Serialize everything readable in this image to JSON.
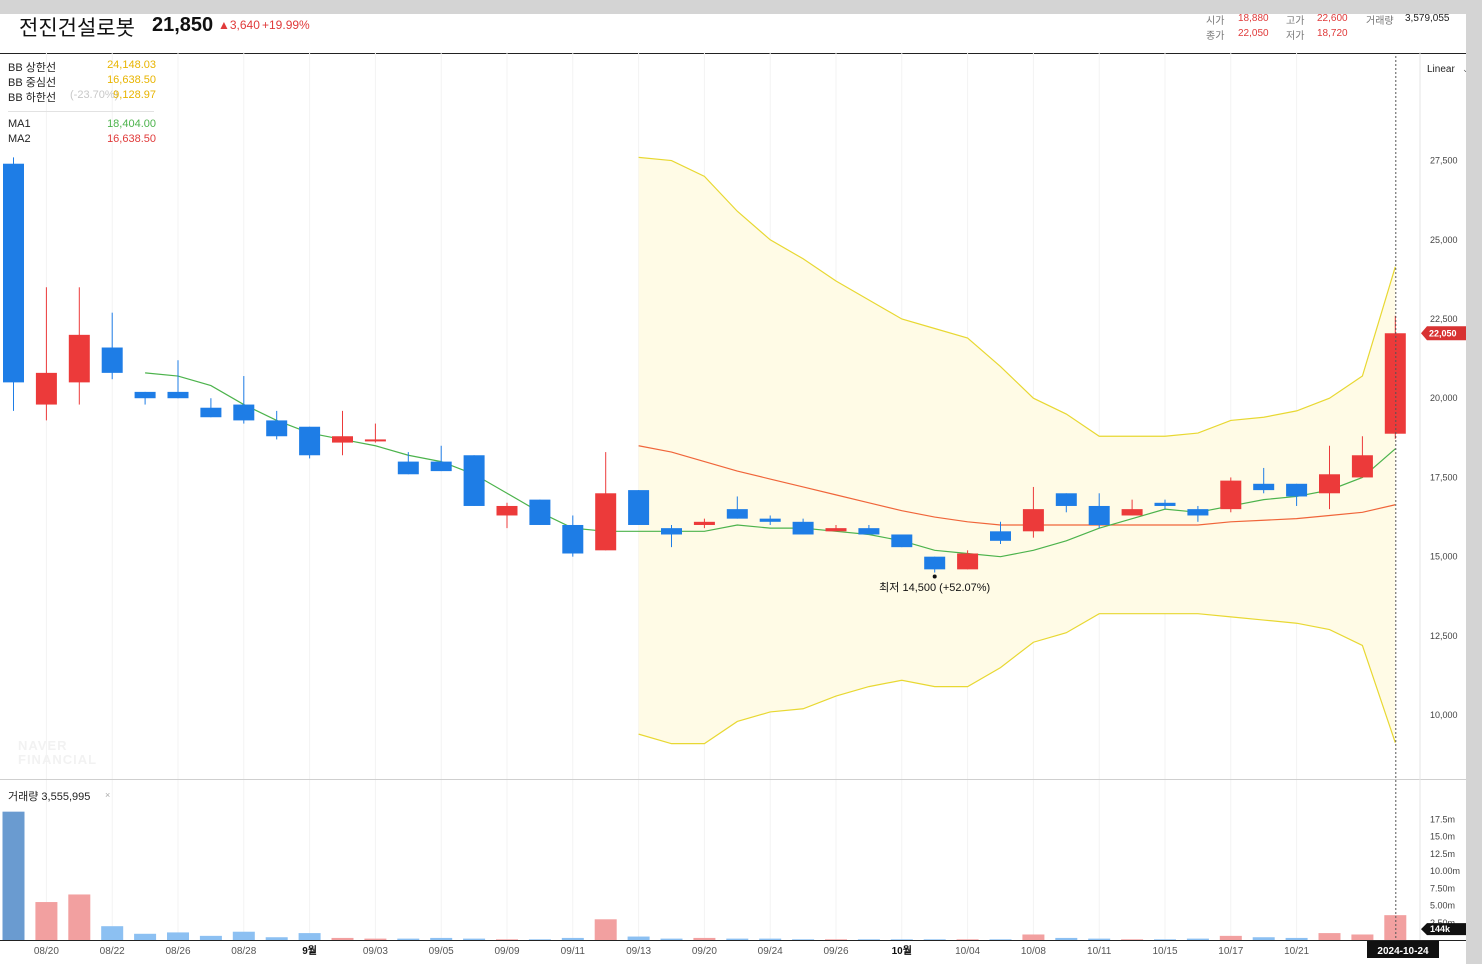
{
  "header": {
    "name": "전진건설로봇",
    "price": "21,850",
    "change": "▲3,640",
    "change_pct": "+19.99%",
    "open_label": "시가",
    "open_value": "18,880",
    "high_label": "고가",
    "high_value": "22,600",
    "volume_label": "거래량",
    "volume_value": "3,579,055",
    "close_label": "종가",
    "close_value": "22,050",
    "low_label": "저가",
    "low_value": "18,720"
  },
  "legend": {
    "bb_upper": {
      "label": "BB 상한선",
      "value": "24,148.03"
    },
    "bb_middle": {
      "label": "BB 중심선",
      "value": "16,638.50"
    },
    "bb_lower": {
      "label": "BB 하한선",
      "value": "9,128.97",
      "ghost": "(-23.70%)"
    },
    "ma1": {
      "label": "MA1",
      "value": "18,404.00"
    },
    "ma2": {
      "label": "MA2",
      "value": "16,638.50"
    }
  },
  "scale_mode": "Linear",
  "volume_panel": {
    "label": "거래량 3,555,995",
    "close": "×"
  },
  "watermark": {
    "line1": "NAVER",
    "line2": "FINANCIAL"
  },
  "colors": {
    "up": "#ec3a3a",
    "down": "#1e7de6",
    "up_volume": "#f2a0a0",
    "down_volume": "#8cc0f2",
    "ma1": "#4cb34c",
    "ma2": "#f0653a",
    "bb_band": "#e8d832",
    "bb_fill": "#fffbe6",
    "legend_bb": "#e8b400",
    "legend_ma1": "#4cb34c",
    "legend_ma2": "#e03a3a"
  },
  "chart_data": {
    "type": "candlestick",
    "price_axis": {
      "min": 8000,
      "max": 29000,
      "ticks": [
        "27,500",
        "25,000",
        "22,500",
        "20,000",
        "17,500",
        "15,000",
        "12,500",
        "10,000"
      ]
    },
    "volume_axis": {
      "ticks": [
        "17.5m",
        "15.0m",
        "12.5m",
        "10.00m",
        "7.50m",
        "5.00m",
        "2.50m"
      ]
    },
    "x_tick_labels": [
      {
        "i": 1,
        "label": "08/20"
      },
      {
        "i": 3,
        "label": "08/22"
      },
      {
        "i": 5,
        "label": "08/26"
      },
      {
        "i": 7,
        "label": "08/28"
      },
      {
        "i": 9,
        "label": "9월"
      },
      {
        "i": 11,
        "label": "09/03"
      },
      {
        "i": 13,
        "label": "09/05"
      },
      {
        "i": 15,
        "label": "09/09"
      },
      {
        "i": 17,
        "label": "09/11"
      },
      {
        "i": 19,
        "label": "09/13"
      },
      {
        "i": 21,
        "label": "09/20"
      },
      {
        "i": 23,
        "label": "09/24"
      },
      {
        "i": 25,
        "label": "09/26"
      },
      {
        "i": 27,
        "label": "10월"
      },
      {
        "i": 29,
        "label": "10/04"
      },
      {
        "i": 31,
        "label": "10/08"
      },
      {
        "i": 33,
        "label": "10/11"
      },
      {
        "i": 35,
        "label": "10/15"
      },
      {
        "i": 37,
        "label": "10/17"
      },
      {
        "i": 39,
        "label": "10/21"
      }
    ],
    "current_date": "2024-10-24",
    "current_price_tag": "22,050",
    "current_volume_tag": "144k",
    "low_annotation": {
      "index": 28,
      "price": 14500,
      "text": "최저 14,500 (+52.07%)"
    },
    "candles": [
      {
        "o": 27400,
        "h": 27600,
        "l": 19600,
        "c": 20500
      },
      {
        "o": 19800,
        "h": 23500,
        "l": 19300,
        "c": 20800
      },
      {
        "o": 20500,
        "h": 23500,
        "l": 19800,
        "c": 22000
      },
      {
        "o": 21600,
        "h": 22700,
        "l": 20600,
        "c": 20800
      },
      {
        "o": 20200,
        "h": 20200,
        "l": 19800,
        "c": 20000
      },
      {
        "o": 20200,
        "h": 21200,
        "l": 20000,
        "c": 20000
      },
      {
        "o": 19700,
        "h": 20000,
        "l": 19400,
        "c": 19400
      },
      {
        "o": 19800,
        "h": 20700,
        "l": 19200,
        "c": 19300
      },
      {
        "o": 19300,
        "h": 19600,
        "l": 18700,
        "c": 18800
      },
      {
        "o": 19100,
        "h": 19100,
        "l": 18100,
        "c": 18200
      },
      {
        "o": 18600,
        "h": 19600,
        "l": 18200,
        "c": 18800
      },
      {
        "o": 18700,
        "h": 19200,
        "l": 18600,
        "c": 18700
      },
      {
        "o": 18000,
        "h": 18300,
        "l": 17600,
        "c": 17600
      },
      {
        "o": 18000,
        "h": 18500,
        "l": 17700,
        "c": 17700
      },
      {
        "o": 18200,
        "h": 18200,
        "l": 16600,
        "c": 16600
      },
      {
        "o": 16300,
        "h": 16700,
        "l": 15900,
        "c": 16600
      },
      {
        "o": 16800,
        "h": 16800,
        "l": 16000,
        "c": 16000
      },
      {
        "o": 16000,
        "h": 16300,
        "l": 15000,
        "c": 15100
      },
      {
        "o": 15200,
        "h": 18300,
        "l": 15200,
        "c": 17000
      },
      {
        "o": 17100,
        "h": 17100,
        "l": 16000,
        "c": 16000
      },
      {
        "o": 15900,
        "h": 16000,
        "l": 15300,
        "c": 15700
      },
      {
        "o": 16000,
        "h": 16200,
        "l": 15900,
        "c": 16100
      },
      {
        "o": 16500,
        "h": 16900,
        "l": 16200,
        "c": 16200
      },
      {
        "o": 16200,
        "h": 16300,
        "l": 16000,
        "c": 16100
      },
      {
        "o": 16100,
        "h": 16200,
        "l": 15700,
        "c": 15700
      },
      {
        "o": 15800,
        "h": 16000,
        "l": 15800,
        "c": 15900
      },
      {
        "o": 15900,
        "h": 16000,
        "l": 15700,
        "c": 15700
      },
      {
        "o": 15700,
        "h": 15700,
        "l": 15300,
        "c": 15300
      },
      {
        "o": 15000,
        "h": 15000,
        "l": 14500,
        "c": 14600
      },
      {
        "o": 14600,
        "h": 15200,
        "l": 14600,
        "c": 15100
      },
      {
        "o": 15800,
        "h": 16100,
        "l": 15400,
        "c": 15500
      },
      {
        "o": 15800,
        "h": 17200,
        "l": 15600,
        "c": 16500
      },
      {
        "o": 17000,
        "h": 17000,
        "l": 16400,
        "c": 16600
      },
      {
        "o": 16600,
        "h": 17000,
        "l": 15900,
        "c": 16000
      },
      {
        "o": 16300,
        "h": 16800,
        "l": 16300,
        "c": 16500
      },
      {
        "o": 16700,
        "h": 16800,
        "l": 16500,
        "c": 16600
      },
      {
        "o": 16500,
        "h": 16600,
        "l": 16100,
        "c": 16300
      },
      {
        "o": 16500,
        "h": 17500,
        "l": 16400,
        "c": 17400
      },
      {
        "o": 17300,
        "h": 17800,
        "l": 17000,
        "c": 17100
      },
      {
        "o": 17300,
        "h": 17300,
        "l": 16600,
        "c": 16900
      },
      {
        "o": 17000,
        "h": 18500,
        "l": 16500,
        "c": 17600
      },
      {
        "o": 17500,
        "h": 18800,
        "l": 17500,
        "c": 18200
      },
      {
        "o": 18880,
        "h": 22600,
        "l": 18720,
        "c": 22050
      }
    ],
    "volumes": [
      18.6,
      5.5,
      6.6,
      2.0,
      0.9,
      1.1,
      0.6,
      1.2,
      0.4,
      1.0,
      0.3,
      0.2,
      0.2,
      0.3,
      0.2,
      0.1,
      0.1,
      0.3,
      3.0,
      0.5,
      0.2,
      0.3,
      0.2,
      0.2,
      0.1,
      0.1,
      0.1,
      0.1,
      0.1,
      0.1,
      0.1,
      0.8,
      0.3,
      0.2,
      0.1,
      0.1,
      0.2,
      0.6,
      0.4,
      0.3,
      1.0,
      0.8,
      3.6
    ],
    "ma1": [
      null,
      null,
      null,
      null,
      20800,
      20700,
      20400,
      19800,
      19300,
      18900,
      18700,
      18500,
      18200,
      18000,
      17600,
      17000,
      16400,
      15900,
      15800,
      15800,
      15800,
      15800,
      16000,
      15900,
      15900,
      15800,
      15700,
      15500,
      15200,
      15100,
      15000,
      15200,
      15500,
      15900,
      16200,
      16500,
      16400,
      16600,
      16800,
      16900,
      17100,
      17500,
      18404
    ],
    "ma2": [
      null,
      null,
      null,
      null,
      null,
      null,
      null,
      null,
      null,
      null,
      null,
      null,
      null,
      null,
      null,
      null,
      null,
      null,
      null,
      18500,
      18300,
      18000,
      17700,
      17450,
      17200,
      16950,
      16700,
      16450,
      16250,
      16100,
      16000,
      16000,
      16000,
      16000,
      16000,
      16000,
      16000,
      16100,
      16150,
      16200,
      16300,
      16400,
      16638.5
    ],
    "bb_upper": [
      null,
      null,
      null,
      null,
      null,
      null,
      null,
      null,
      null,
      null,
      null,
      null,
      null,
      null,
      null,
      null,
      null,
      null,
      null,
      27600,
      27500,
      27000,
      25900,
      25000,
      24400,
      23700,
      23100,
      22500,
      22200,
      21900,
      21000,
      20000,
      19500,
      18800,
      18800,
      18800,
      18900,
      19300,
      19400,
      19600,
      20000,
      20700,
      24148.03
    ],
    "bb_lower": [
      null,
      null,
      null,
      null,
      null,
      null,
      null,
      null,
      null,
      null,
      null,
      null,
      null,
      null,
      null,
      null,
      null,
      null,
      null,
      9400,
      9100,
      9100,
      9800,
      10100,
      10200,
      10600,
      10900,
      11100,
      10900,
      10900,
      11500,
      12300,
      12600,
      13200,
      13200,
      13200,
      13200,
      13100,
      13000,
      12900,
      12700,
      12200,
      9128.97
    ]
  }
}
